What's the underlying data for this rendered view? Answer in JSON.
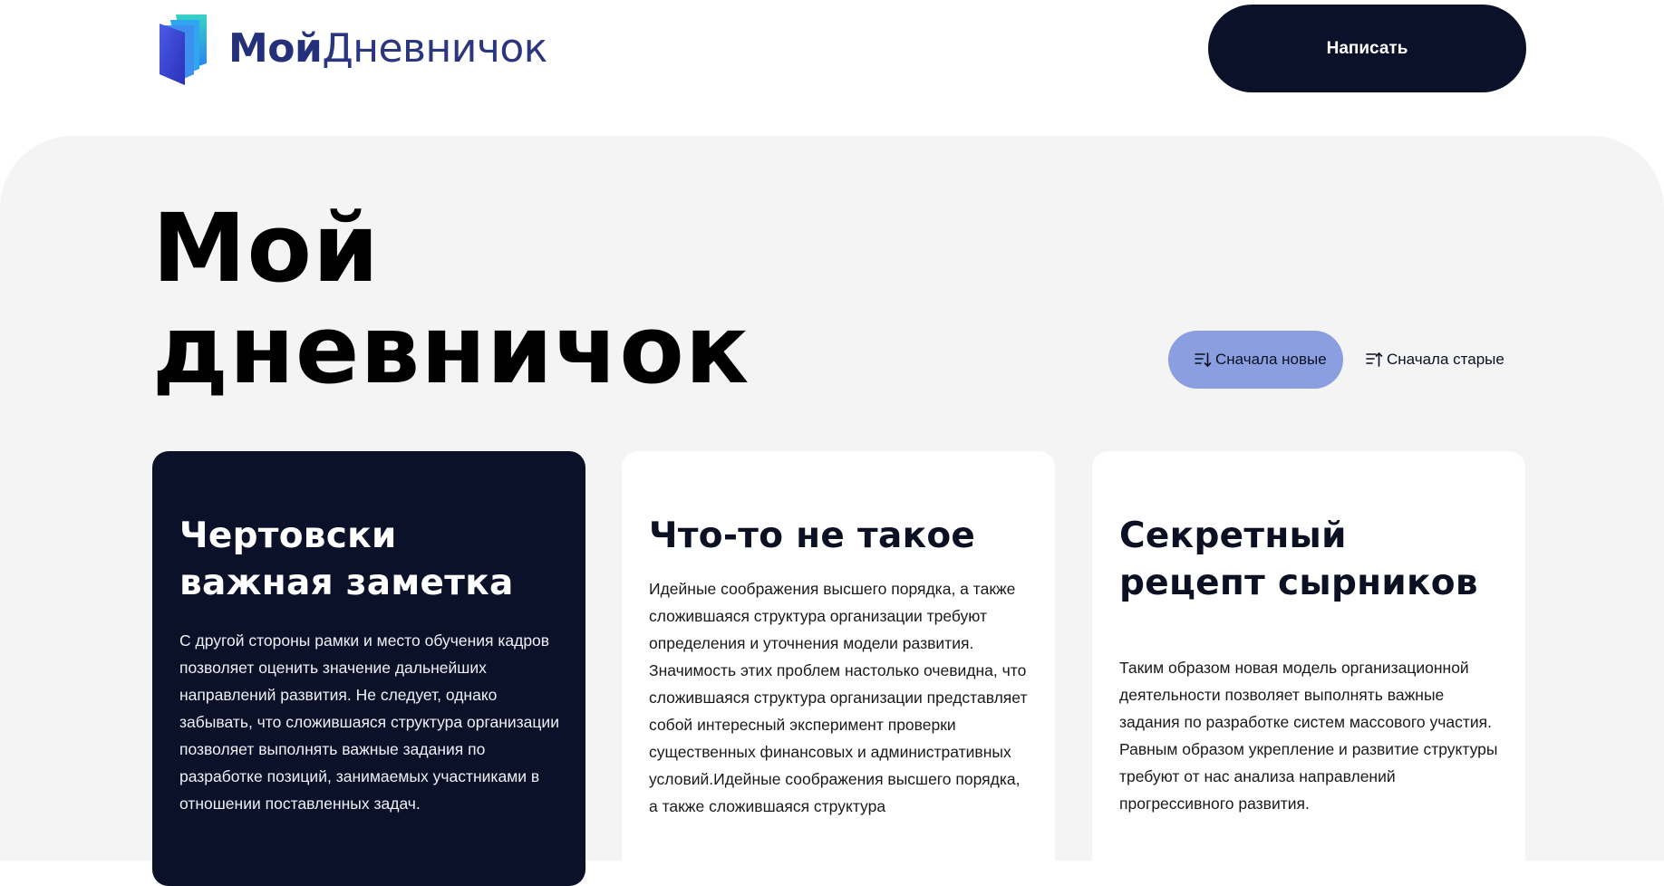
{
  "header": {
    "logo": {
      "text_bold": "Мой",
      "text_light": "Дневничок",
      "icon": "book-icon",
      "colors": {
        "cover": "#3b3fd1",
        "pages": "#2aa6f2"
      }
    },
    "write_button_label": "Написать"
  },
  "page": {
    "title_line1": "Мой",
    "title_line2": "дневничок"
  },
  "sort": {
    "newest": {
      "label": "Сначала новые",
      "icon": "sort-descending-icon",
      "active": true
    },
    "oldest": {
      "label": "Сначала старые",
      "icon": "sort-ascending-icon",
      "active": false
    },
    "active_color": "#8b9fe0"
  },
  "notes": [
    {
      "title": "Чертовски важная заметка",
      "body": "С другой стороны рамки и место обучения кадров позволяет оценить значение дальнейших направлений развития. Не следует, однако забывать, что сложившаяся структура организации позволяет выполнять важные задания по разработке позиций, занимаемых участниками в отношении поставленных задач.",
      "theme": "dark"
    },
    {
      "title": "Что-то не такое",
      "body": "Идейные соображения высшего порядка, а также сложившаяся структура организации требуют определения и уточнения модели развития. Значимость этих проблем настолько очевидна, что сложившаяся структура организации представляет собой интересный эксперимент проверки существенных финансовых и административных условий.Идейные соображения высшего порядка, а также сложившаяся структура",
      "theme": "light"
    },
    {
      "title": "Секретный рецепт сырников",
      "body": "Таким образом новая модель организационной деятельности позволяет выполнять важные задания по разработке систем массового участия. Равным образом укрепление и развитие структуры требуют от нас анализа направлений прогрессивного развития.",
      "theme": "light"
    }
  ],
  "colors": {
    "dark_navy": "#0a1128",
    "background": "#f4f4f5",
    "card": "#ffffff"
  }
}
